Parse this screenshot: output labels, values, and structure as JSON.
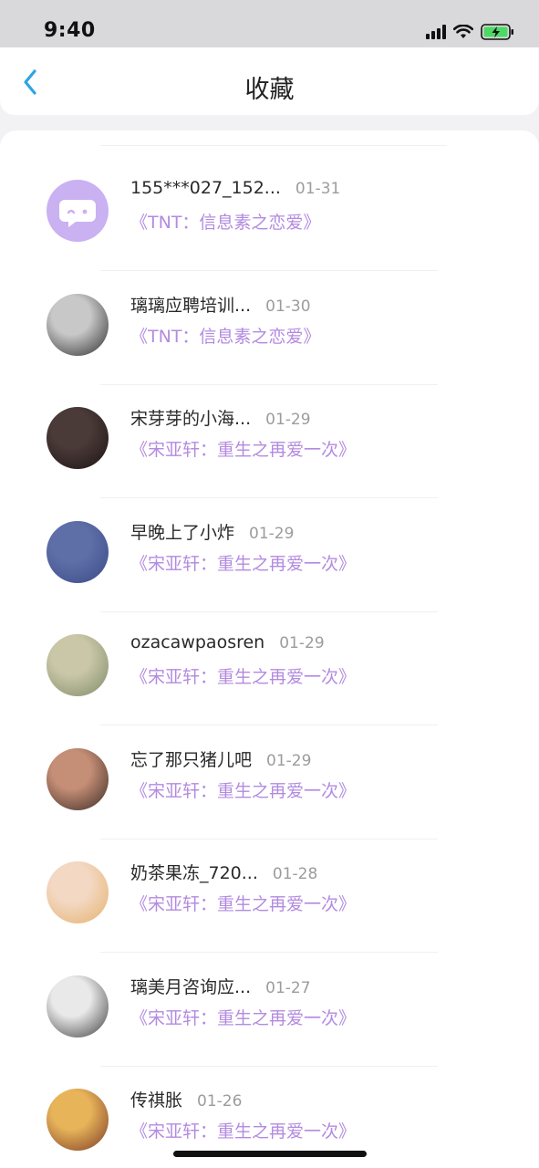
{
  "status": {
    "time": "9:40"
  },
  "header": {
    "title": "收藏"
  },
  "items": [
    {
      "name": "155***027_152...",
      "date": "01-31",
      "work": "《TNT：信息素之恋爱》",
      "avatar": "chat-bubble-icon",
      "avatar_colors": [
        "#c9b1f2",
        "#d9c6f7"
      ]
    },
    {
      "name": "璃璃应聘培训...",
      "date": "01-30",
      "work": "《TNT：信息素之恋爱》",
      "avatar": "user-avatar",
      "avatar_colors": [
        "#c8c8c8",
        "#2b2b2b"
      ]
    },
    {
      "name": "宋芽芽的小海...",
      "date": "01-29",
      "work": "《宋亚轩：重生之再爱一次》",
      "avatar": "user-avatar",
      "avatar_colors": [
        "#4a3a38",
        "#1c1514"
      ]
    },
    {
      "name": "早晚上了小炸",
      "date": "01-29",
      "work": "《宋亚轩：重生之再爱一次》",
      "avatar": "user-avatar",
      "avatar_colors": [
        "#5e6fa8",
        "#3a4a86"
      ]
    },
    {
      "name": "ozacawpaosren",
      "date": "01-29",
      "work": "《宋亚轩：重生之再爱一次》",
      "avatar": "user-avatar",
      "avatar_colors": [
        "#c9c7a8",
        "#7f8a66"
      ]
    },
    {
      "name": "忘了那只猪儿吧",
      "date": "01-29",
      "work": "《宋亚轩：重生之再爱一次》",
      "avatar": "user-avatar",
      "avatar_colors": [
        "#c58e76",
        "#3a2a24"
      ]
    },
    {
      "name": "奶茶果冻_720...",
      "date": "01-28",
      "work": "《宋亚轩：重生之再爱一次》",
      "avatar": "user-avatar",
      "avatar_colors": [
        "#f3d8c4",
        "#e5b26a"
      ]
    },
    {
      "name": "璃美月咨询应...",
      "date": "01-27",
      "work": "《宋亚轩：重生之再爱一次》",
      "avatar": "user-avatar",
      "avatar_colors": [
        "#e9e9e9",
        "#3c3c3c"
      ]
    },
    {
      "name": "传祺胀",
      "date": "01-26",
      "work": "《宋亚轩：重生之再爱一次》",
      "avatar": "user-avatar",
      "avatar_colors": [
        "#e8b45a",
        "#7a3a24"
      ]
    }
  ],
  "colors": {
    "accent": "#2fa3e6",
    "work_title": "#b38be0"
  }
}
